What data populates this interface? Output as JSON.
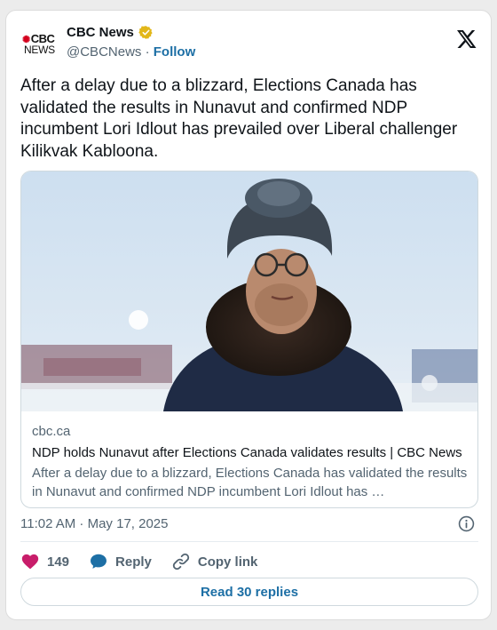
{
  "author": {
    "name": "CBC News",
    "handle": "@CBCNews",
    "separator": "·",
    "follow_label": "Follow",
    "logo_top": "CBC",
    "logo_bottom": "NEWS"
  },
  "tweet": {
    "text": "After a delay due to a blizzard, Elections Canada has validated the results in Nunavut and confirmed NDP incumbent Lori Idlout has prevailed over Liberal challenger Kilikvak Kabloona."
  },
  "link_card": {
    "domain": "cbc.ca",
    "title": "NDP holds Nunavut after Elections Canada validates results | CBC News",
    "description": "After a delay due to a blizzard, Elections Canada has validated the results in Nunavut and confirmed NDP incumbent Lori Idlout has …"
  },
  "timestamp": "11:02 AM · May 17, 2025",
  "actions": {
    "likes": "149",
    "reply_label": "Reply",
    "copy_label": "Copy link"
  },
  "replies_button": "Read 30 replies",
  "colors": {
    "accent": "#1d6fa5",
    "like": "#c81d6a",
    "brand": "#d4001c",
    "verified": "#e2b719"
  },
  "icons": [
    "cbc-logo",
    "verified-badge-icon",
    "x-logo-icon",
    "info-icon",
    "heart-icon",
    "reply-icon",
    "link-icon"
  ]
}
